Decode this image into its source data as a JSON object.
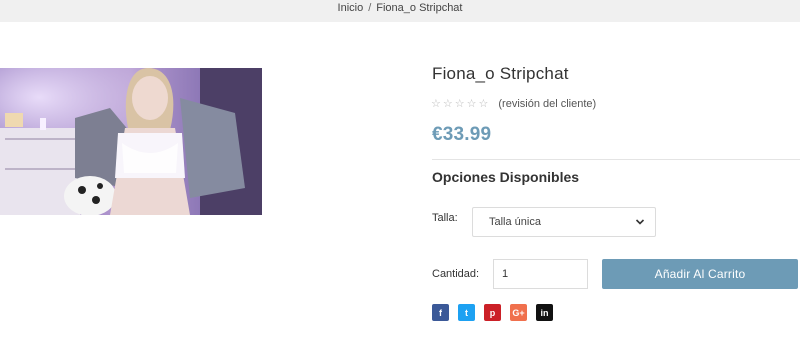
{
  "breadcrumb": {
    "home": "Inicio",
    "separator": "/",
    "current": "Fiona_o Stripchat"
  },
  "product": {
    "title": "Fiona_o Stripchat",
    "rating": {
      "stars": [
        "☆",
        "☆",
        "☆",
        "☆",
        "☆"
      ],
      "filled": 0,
      "review_label": "(revisión del cliente)"
    },
    "price": "€33.99"
  },
  "options": {
    "heading": "Opciones Disponibles",
    "size_label": "Talla:",
    "size_selected": "Talla única"
  },
  "quantity": {
    "label": "Cantidad:",
    "value": "1"
  },
  "cart": {
    "button_label": "Añadir Al Carrito"
  },
  "social": [
    {
      "name": "facebook-share-icon",
      "glyph": "f",
      "color": "#3b5998"
    },
    {
      "name": "twitter-share-icon",
      "glyph": "t",
      "color": "#1da1f2"
    },
    {
      "name": "pinterest-share-icon",
      "glyph": "p",
      "color": "#cb2027"
    },
    {
      "name": "google-plus-share-icon",
      "glyph": "G+",
      "color": "#f0704d"
    },
    {
      "name": "linkedin-share-icon",
      "glyph": "in",
      "color": "#111111"
    }
  ],
  "colors": {
    "accent": "#6d9bb6",
    "topbar": "#f0f0f0"
  }
}
